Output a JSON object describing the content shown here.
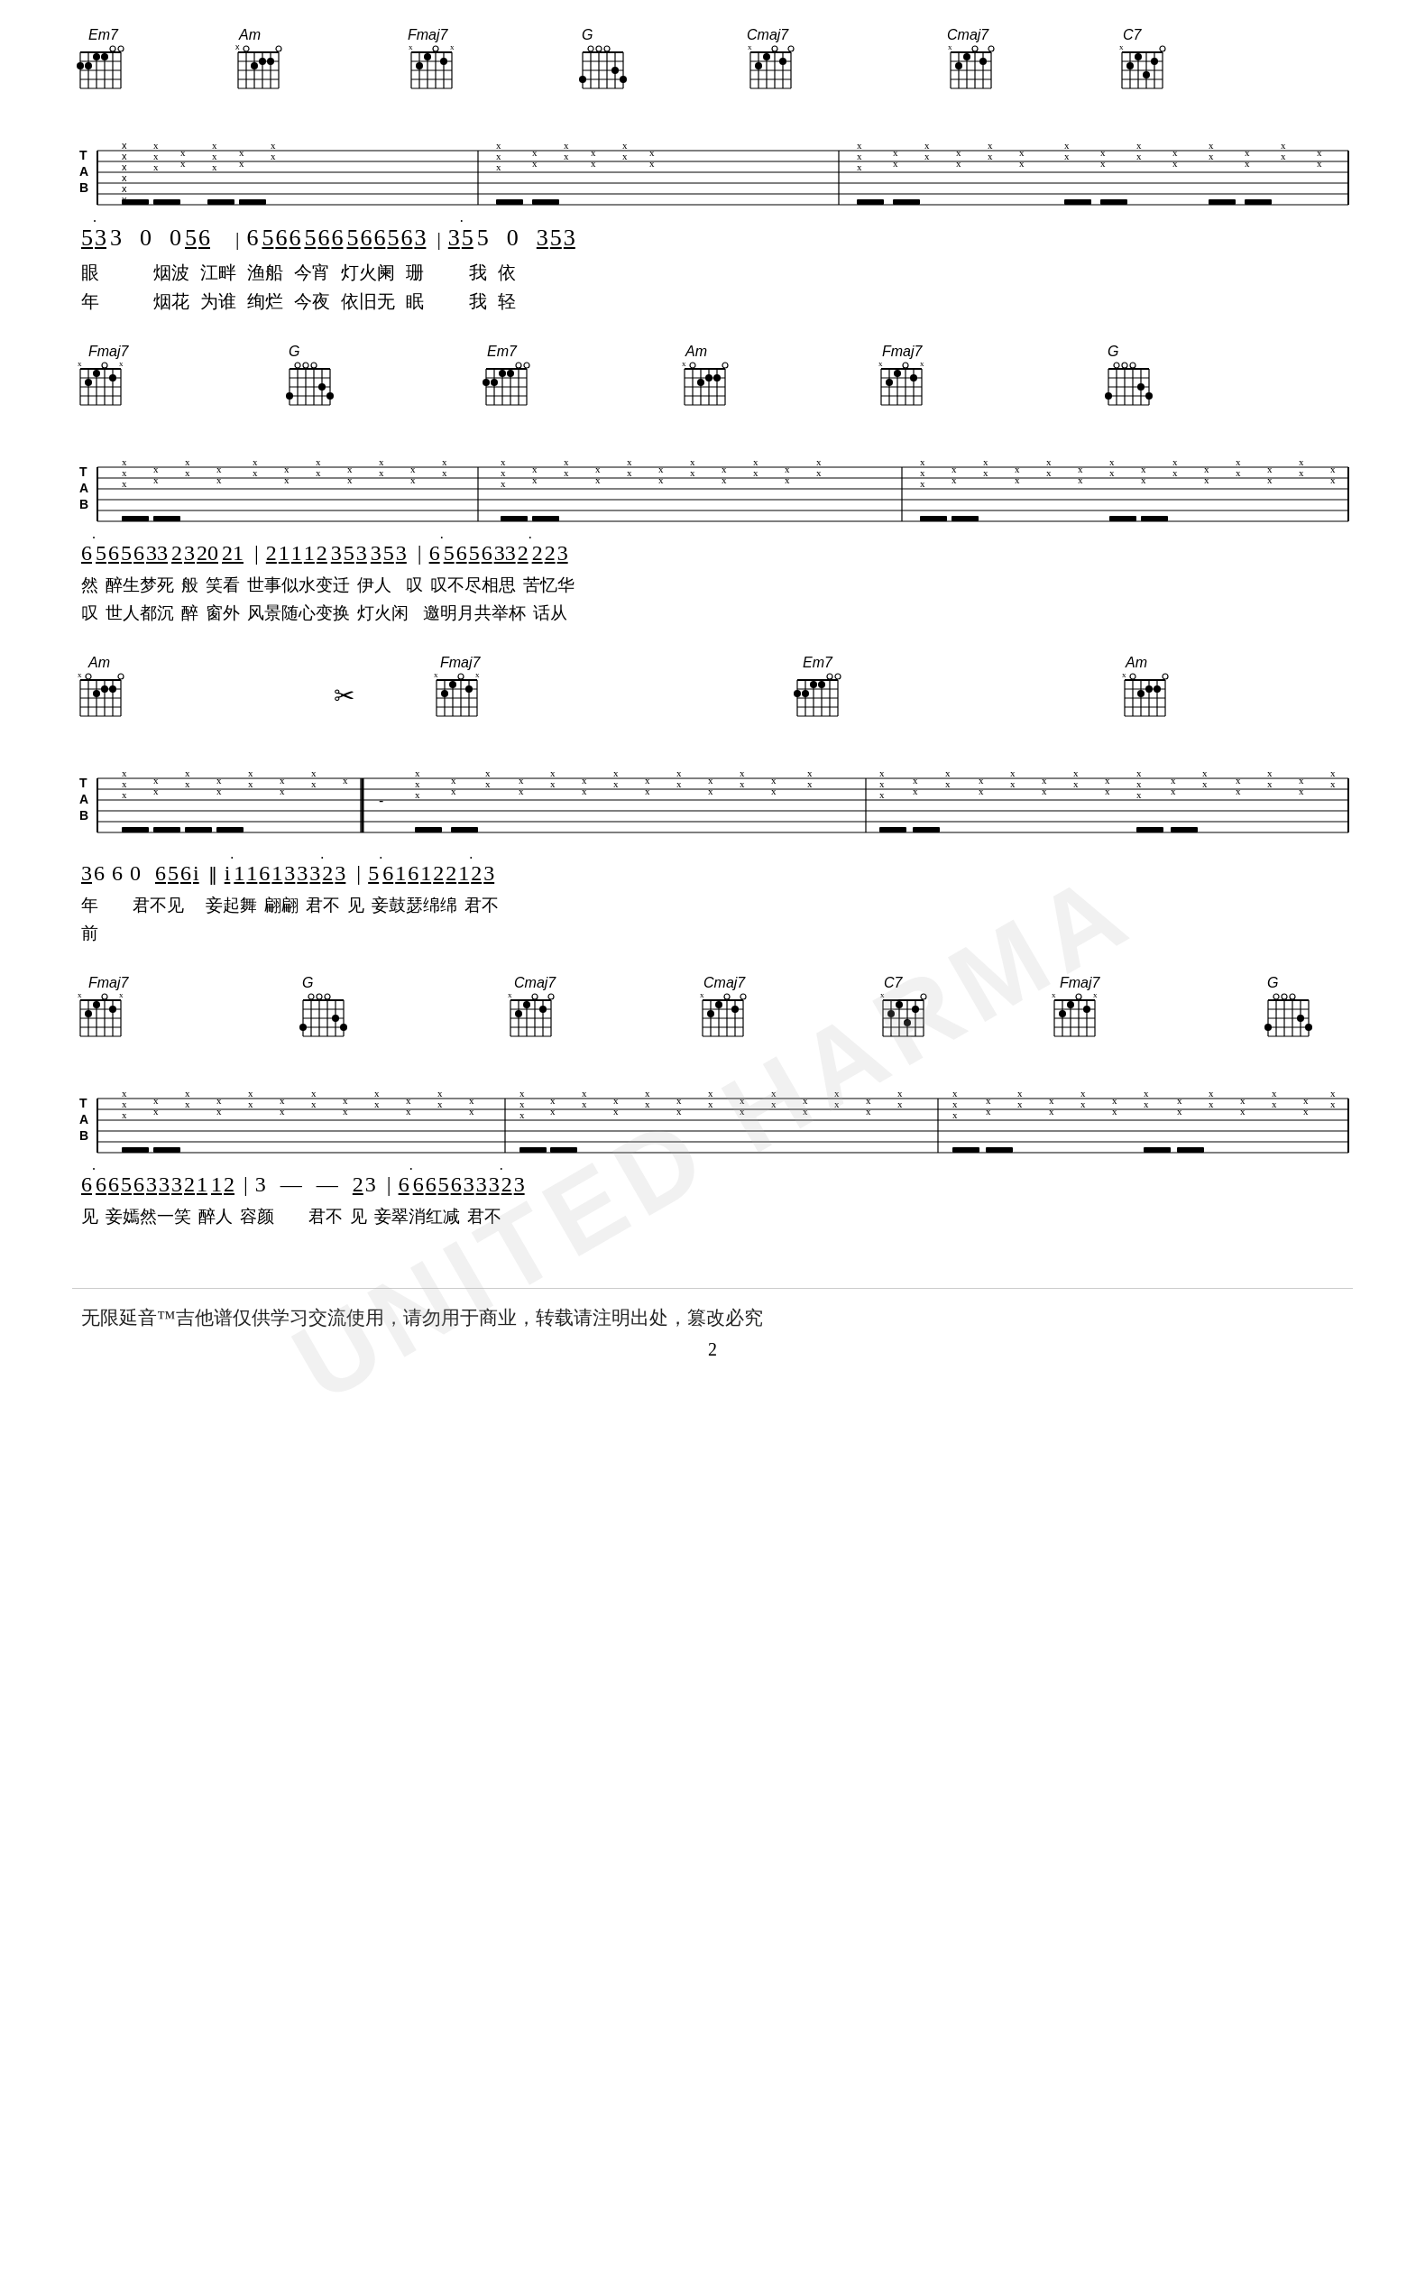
{
  "watermark": "UNITED HARMA",
  "sections": [
    {
      "id": "section1",
      "chords": [
        "Em7",
        "Am",
        "Fmaj7",
        "G",
        "Cmaj7",
        "Cmaj7",
        "C7"
      ],
      "notation": "53·3  0  056 | 6 566 566 5665 63 | 35·5  0   353",
      "lyrics1": "眼        烟波  江畔  渔船  今宵  灯火阑  珊          我  依",
      "lyrics2": "年        烟花  为谁  绚烂  今夜  依旧无  眠          我  轻"
    },
    {
      "id": "section2",
      "chords": [
        "Fmaj7",
        "G",
        "Em7",
        "Am",
        "Fmaj7",
        "G"
      ],
      "notation": "6· 5656 33 2320 21 | 2 1112 353 353 | 6· 5656 332· 223",
      "lyrics1": "然  醉生梦死  般  笑看  世事似水变迁   伊人  叹  叹不尽相思  苦忆华",
      "lyrics2": "叹  世人都沉  醉  窗外  风景随心变换   灯火闲  邀明月共举杯  话从"
    },
    {
      "id": "section3",
      "chords": [
        "Am",
        "Fmaj7",
        "Em7",
        "Am"
      ],
      "notation": "3 6 6  0  656i‖ i· 1 16 1332· 23 | 5· 6 16 1 221· 23",
      "lyrics1": "年        君不见   妾起舞  翩翩  君不  见  妾鼓瑟绵绵    君不",
      "lyrics2": "前"
    },
    {
      "id": "section4",
      "chords": [
        "Fmaj7",
        "G",
        "Cmaj7",
        "Cmaj7",
        "C7",
        "Fmaj7",
        "G"
      ],
      "notation": "6· 6656 332 112 | 3  —  23 | 6· 6656 332· 23",
      "lyrics1": "见  妾嫣然一笑  醉人  容颜          君不  见  妾翠消红减  君不",
      "lyrics2": ""
    }
  ],
  "footer": {
    "text": "无限延音™吉他谱仅供学习交流使用，请勿用于商业，转载请注明出处，篡改必究",
    "page_number": "2"
  }
}
